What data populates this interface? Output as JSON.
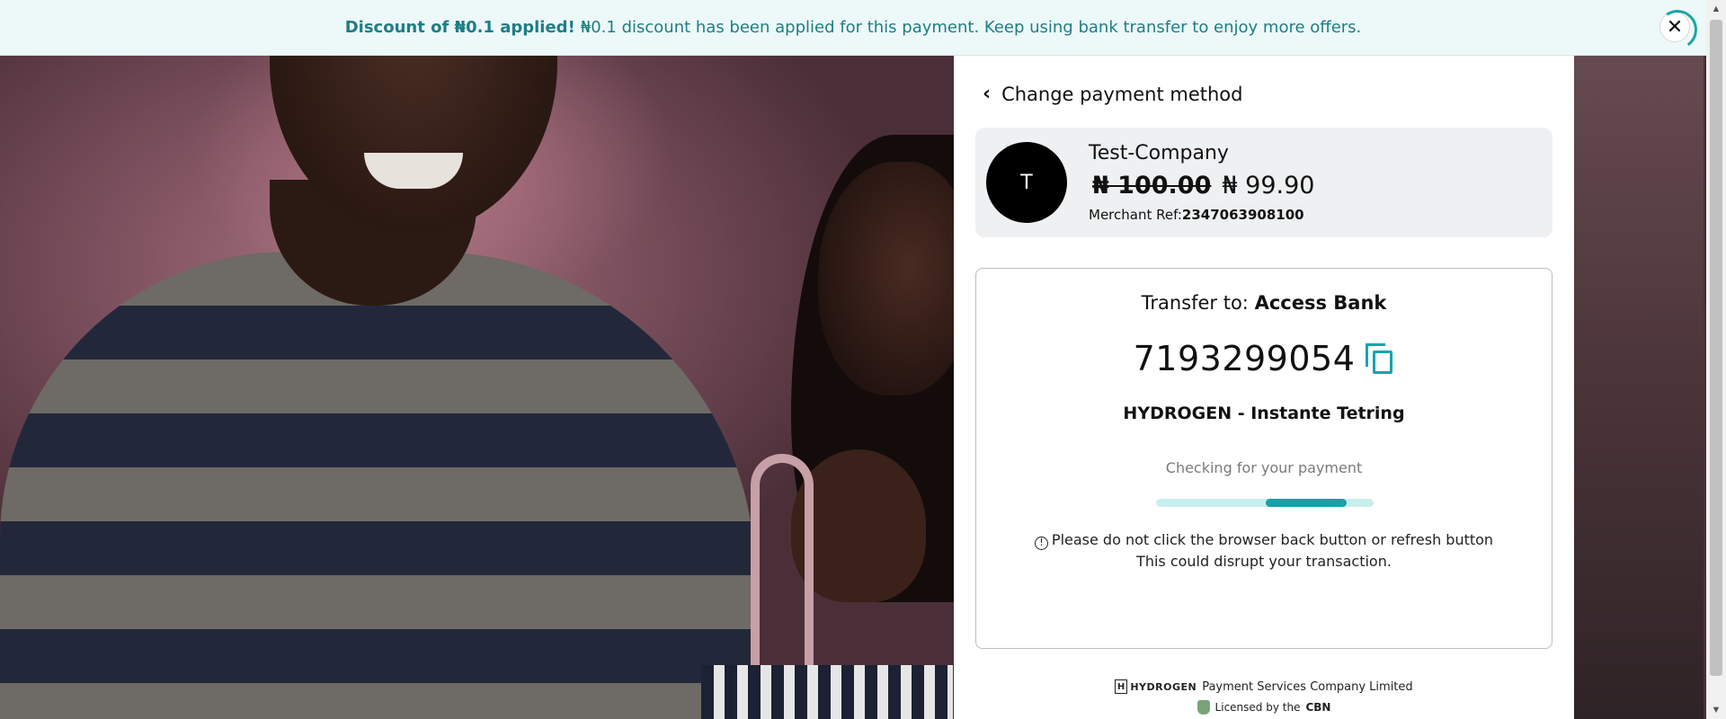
{
  "banner": {
    "bold_text": "Discount of ₦0.1 applied!",
    "text": "₦0.1 discount has been applied for this payment. Keep using bank transfer to enjoy more offers.",
    "close_icon": "✕"
  },
  "panel": {
    "back_label": "Change payment method",
    "back_icon": "‹",
    "merchant": {
      "avatar_letter": "T",
      "name": "Test-Company",
      "price_original": "₦ 100.00",
      "price_discounted": "₦ 99.90",
      "ref_label": "Merchant Ref:",
      "ref_value": "2347063908100"
    },
    "transfer": {
      "prefix": "Transfer to:",
      "bank": "Access Bank",
      "account_number": "7193299054",
      "account_name": "HYDROGEN - Instante Tetring",
      "status": "Checking for your payment",
      "progress": 0.4,
      "warning_line1": "Please do not click the browser back button or refresh button",
      "warning_line2": "This could disrupt your transaction.",
      "warning_icon": "!"
    },
    "footer": {
      "logo_letter": "H",
      "logo_text": "HYDROGEN",
      "company": "Payment Services Company Limited",
      "license_prefix": "Licensed by the",
      "license_body": "CBN"
    }
  },
  "colors": {
    "accent": "#14a3a6",
    "banner_bg": "#edf8f8",
    "banner_text": "#1d7e85"
  },
  "icons": [
    "close-icon",
    "chevron-left-icon",
    "copy-icon",
    "info-icon",
    "hydrogen-logo-icon",
    "cbn-icon"
  ]
}
